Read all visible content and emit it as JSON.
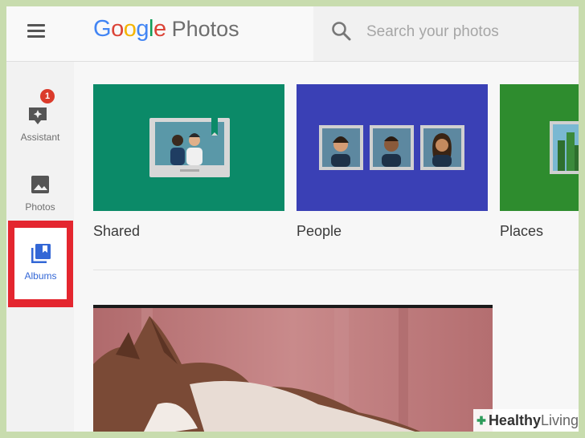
{
  "header": {
    "logo": {
      "letters": [
        "G",
        "o",
        "o",
        "g",
        "l",
        "e"
      ],
      "letter_colors": [
        "#4285f4",
        "#db4437",
        "#f4b400",
        "#4285f4",
        "#0f9d58",
        "#db4437"
      ],
      "product": "Photos"
    },
    "menu_icon": "hamburger-menu-icon",
    "search": {
      "icon": "search-icon",
      "placeholder": "Search your photos"
    }
  },
  "sidebar": {
    "items": [
      {
        "label": "Assistant",
        "icon": "assistant-icon",
        "badge": "1"
      },
      {
        "label": "Photos",
        "icon": "photo-icon"
      },
      {
        "label": "Albums",
        "icon": "albums-icon",
        "selected": true,
        "highlight_color": "#e4262f"
      }
    ]
  },
  "main": {
    "tiles": [
      {
        "label": "Shared",
        "color": "#0b8a68"
      },
      {
        "label": "People",
        "color": "#3a40b5"
      },
      {
        "label": "Places",
        "color": "#2e8c2e"
      }
    ]
  },
  "watermark": {
    "brand_bold": "Healthy",
    "brand_light": "Living",
    "icon": "plus-cross-icon"
  },
  "colors": {
    "accent": "#3367d6",
    "badge": "#db3b2b",
    "frame_border": "#c8dcae"
  }
}
